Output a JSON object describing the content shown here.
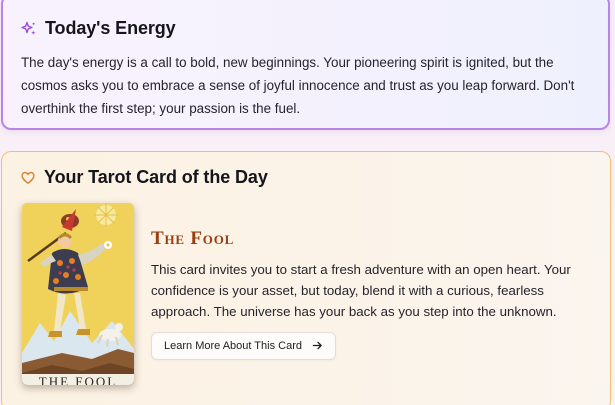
{
  "energy": {
    "title": "Today's Energy",
    "icon": "sparkles-icon",
    "accent": "#9b4fd6",
    "text": "The day's energy is a call to bold, new beginnings. Your pioneering spirit is ignited, but the cosmos asks you to embrace a sense of joyful innocence and trust as you leap forward. Don't overthink the first step; your passion is the fuel."
  },
  "tarot": {
    "title": "Your Tarot Card of the Day",
    "icon": "heart-icon",
    "accent": "#d9802b",
    "card_name": "The Fool",
    "card_caption": "THE FOOL",
    "description": "This card invites you to start a fresh adventure with an open heart. Your confidence is your asset, but today, blend it with a curious, fearless approach. The universe has your back as you step into the unknown.",
    "button_label": "Learn More About This Card",
    "button_icon": "arrow-right-icon"
  }
}
